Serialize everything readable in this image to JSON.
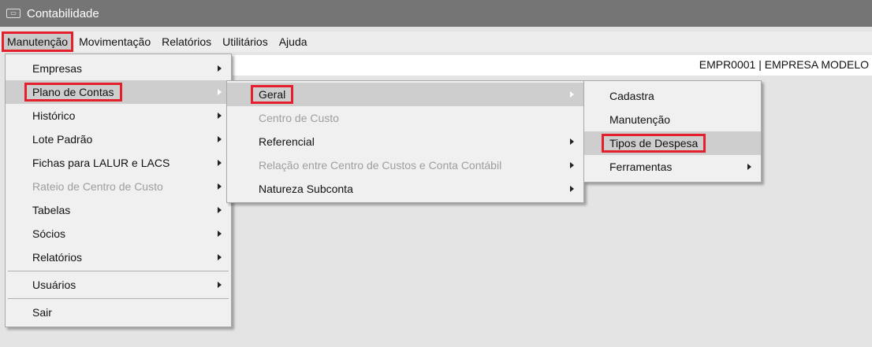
{
  "window": {
    "title": "Contabilidade",
    "icon": "app-icon"
  },
  "menubar": {
    "items": [
      "Manutenção",
      "Movimentação",
      "Relatórios",
      "Utilitários",
      "Ajuda"
    ]
  },
  "company": {
    "label": "EMPR0001 | EMPRESA MODELO"
  },
  "menu_manutencao": {
    "items": [
      {
        "label": "Empresas"
      },
      {
        "label": "Plano de Contas"
      },
      {
        "label": "Histórico"
      },
      {
        "label": "Lote Padrão"
      },
      {
        "label": "Fichas para LALUR e LACS"
      },
      {
        "label": "Rateio de Centro de Custo"
      },
      {
        "label": "Tabelas"
      },
      {
        "label": "Sócios"
      },
      {
        "label": "Relatórios"
      },
      {
        "label": "Usuários"
      },
      {
        "label": "Sair"
      }
    ]
  },
  "menu_plano": {
    "items": [
      {
        "label": "Geral"
      },
      {
        "label": "Centro de Custo"
      },
      {
        "label": "Referencial"
      },
      {
        "label": "Relação entre Centro de Custos e Conta Contábil"
      },
      {
        "label": "Natureza Subconta"
      }
    ]
  },
  "menu_geral": {
    "items": [
      {
        "label": "Cadastra"
      },
      {
        "label": "Manutenção"
      },
      {
        "label": "Tipos de Despesa"
      },
      {
        "label": "Ferramentas"
      }
    ]
  },
  "colors": {
    "highlight_box": "#e3202b",
    "titlebar": "#757575",
    "hover": "#cecece"
  }
}
